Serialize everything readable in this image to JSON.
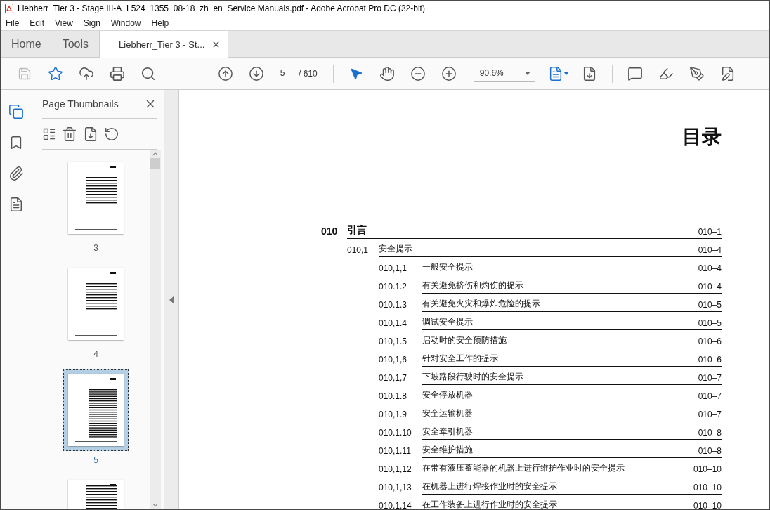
{
  "window": {
    "title": "Liebherr_Tier 3 - Stage III-A_L524_1355_08-18_zh_en_Service Manuals.pdf - Adobe Acrobat Pro DC (32-bit)"
  },
  "menu": [
    "File",
    "Edit",
    "View",
    "Sign",
    "Window",
    "Help"
  ],
  "tabs": [
    {
      "label": "Home",
      "selected": false
    },
    {
      "label": "Tools",
      "selected": false
    },
    {
      "label": "Liebherr_Tier 3 - St...",
      "selected": true
    }
  ],
  "toolbar": {
    "page_number": "5",
    "page_total": "/ 610",
    "zoom": "90.6%"
  },
  "sidebar": {
    "title": "Page Thumbnails",
    "thumbnails": [
      {
        "label": "3",
        "selected": false
      },
      {
        "label": "4",
        "selected": false
      },
      {
        "label": "5",
        "selected": true
      },
      {
        "selected": false
      }
    ]
  },
  "document": {
    "heading": "目录",
    "toc": [
      {
        "number": "010",
        "title": "引言",
        "page": "010–1",
        "children": [
          {
            "number": "010,1",
            "title": "安全提示",
            "page": "010–4",
            "children": [
              {
                "number": "010,1,1",
                "title": "一般安全提示",
                "page": "010–4"
              },
              {
                "number": "010.1.2",
                "title": "有关避免挤伤和灼伤的提示",
                "page": "010–4"
              },
              {
                "number": "010.1.3",
                "title": "有关避免火灾和爆炸危险的提示",
                "page": "010–5"
              },
              {
                "number": "010,1.4",
                "title": "调试安全提示",
                "page": "010–5"
              },
              {
                "number": "010,1.5",
                "title": "启动时的安全预防措施",
                "page": "010–6"
              },
              {
                "number": "010,1,6",
                "title": "针对安全工作的提示",
                "page": "010–6"
              },
              {
                "number": "010,1,7",
                "title": "下坡路段行驶时的安全提示",
                "page": "010–7"
              },
              {
                "number": "010.1.8",
                "title": "安全停放机器",
                "page": "010–7"
              },
              {
                "number": "010,1.9",
                "title": "安全运输机器",
                "page": "010–7"
              },
              {
                "number": "010.1.10",
                "title": "安全牵引机器",
                "page": "010–8"
              },
              {
                "number": "010,1.11",
                "title": "安全维护措施",
                "page": "010–8"
              },
              {
                "number": "010,1,12",
                "title": "在带有液压蓄能器的机器上进行维护作业时的安全提示",
                "page": "010–10"
              },
              {
                "number": "010,1,13",
                "title": "在机器上进行焊接作业时的安全提示",
                "page": "010–10"
              },
              {
                "number": "010,1,14",
                "title": "在工作装备上进行作业时的安全提示",
                "page": "010–10"
              }
            ]
          }
        ]
      }
    ]
  }
}
